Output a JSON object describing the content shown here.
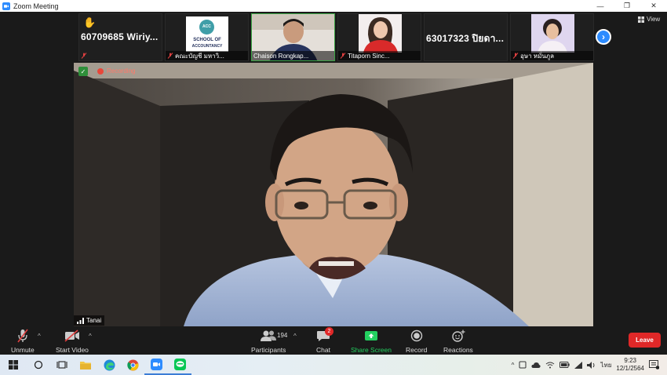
{
  "window": {
    "title": "Zoom Meeting",
    "controls": [
      "minimize",
      "restore",
      "close"
    ]
  },
  "gallery": {
    "tiles": [
      {
        "type": "name",
        "name": "60709685  Wiriy...",
        "hand_raised": true,
        "muted": true,
        "caption": ""
      },
      {
        "type": "logo",
        "logo_text": [
          "ACC",
          "SCHOOL OF",
          "ACCOUNTANCY"
        ],
        "caption": "คณะบัญชี มหาวิ...",
        "muted": true
      },
      {
        "type": "video",
        "caption": "Chaison Rongkap...",
        "muted": false,
        "active": true
      },
      {
        "type": "video",
        "caption": "Titaporn Sinc...",
        "muted": true
      },
      {
        "type": "name",
        "name": "63017323 ปิยดา...",
        "hand_raised": false,
        "muted": false,
        "caption": ""
      },
      {
        "type": "video",
        "caption": "อุษา หมั่นภูล",
        "muted": true
      }
    ],
    "view_label": "View"
  },
  "main_video": {
    "recording_label": "Recording",
    "speaker_name": "Tanai"
  },
  "toolbar": {
    "unmute_label": "Unmute",
    "start_video_label": "Start Video",
    "participants_label": "Participants",
    "participants_count": "194",
    "chat_label": "Chat",
    "chat_badge": "2",
    "share_label": "Share Screen",
    "record_label": "Record",
    "reactions_label": "Reactions",
    "leave_label": "Leave"
  },
  "taskbar": {
    "apps": [
      "start",
      "search",
      "task-view",
      "file-explorer",
      "edge",
      "chrome",
      "zoom",
      "line"
    ],
    "language": "ไทย",
    "time": "9:23",
    "date": "12/1/2564"
  },
  "colors": {
    "accent_blue": "#2d8cff",
    "leave_red": "#e02828",
    "share_green": "#23d160",
    "active_border": "#3aa443"
  }
}
